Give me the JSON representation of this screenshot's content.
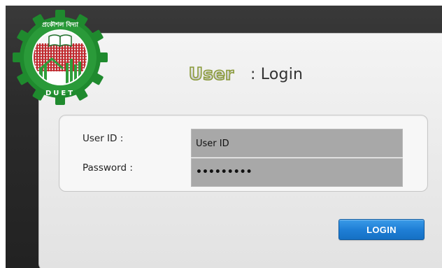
{
  "header": {
    "badge_word": "User",
    "title": ": Login"
  },
  "logo": {
    "top_text": "প্রকৌশল বিদ্যা",
    "bottom_text": "DUET",
    "colors": {
      "gear": "#1f8a2e",
      "inner": "#b7262b",
      "green": "#2e9d3a"
    }
  },
  "form": {
    "user_label": "User ID :",
    "user_value": "User ID",
    "password_label": "Password :",
    "password_value": "•••••••••"
  },
  "actions": {
    "login_label": "LOGIN"
  },
  "colors": {
    "login_button": "#1f7fd6",
    "input_bg": "#a8a8a8"
  }
}
